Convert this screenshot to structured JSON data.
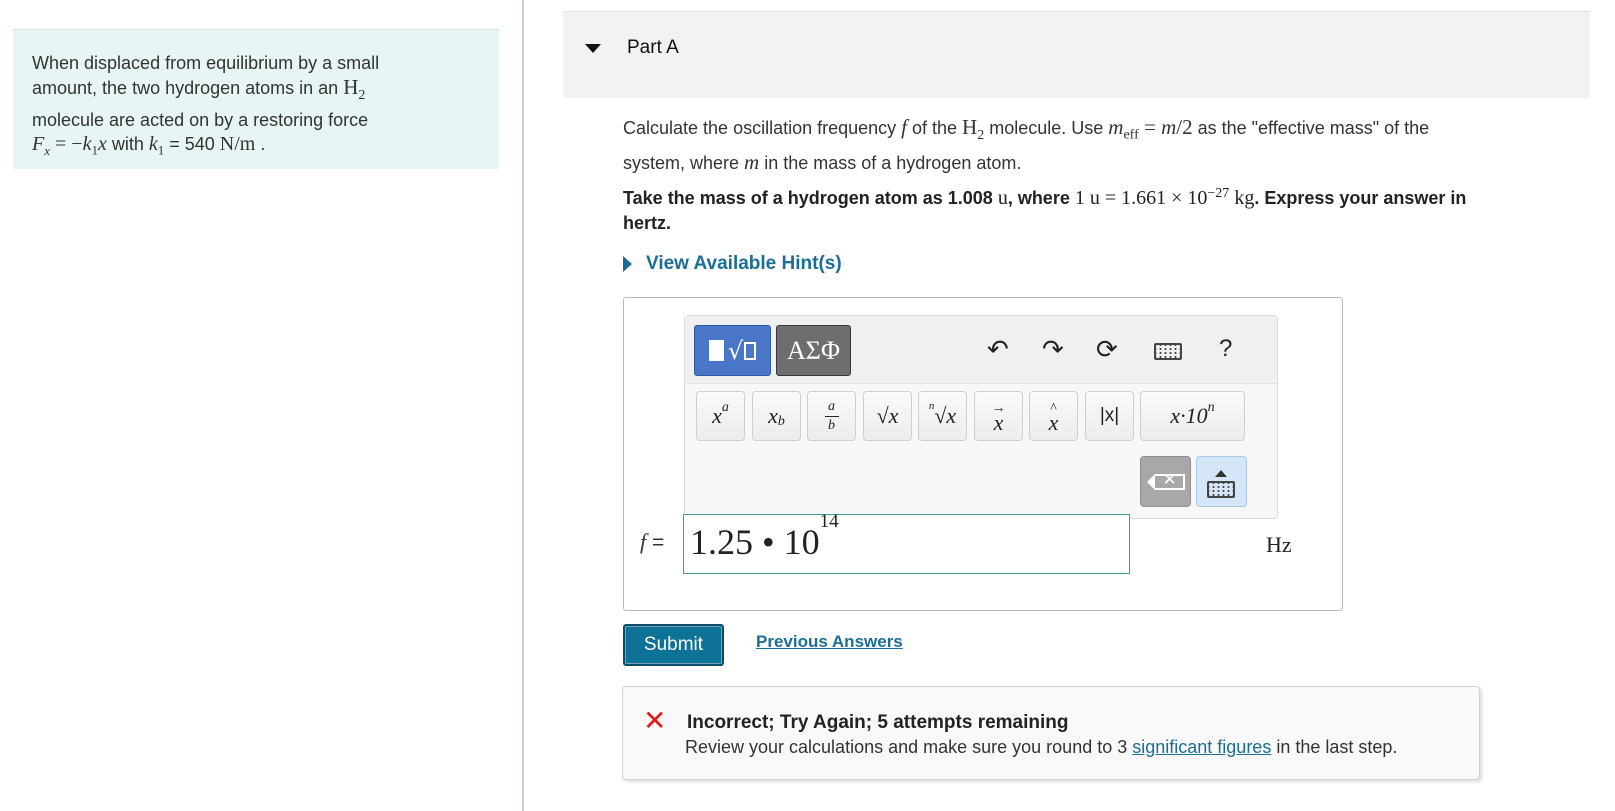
{
  "context": {
    "line1": "When displaced from equilibrium by a small",
    "line2_a": "amount, the two hydrogen atoms in an ",
    "line3": "molecule are acted on by a restoring force",
    "with_text": " with ",
    "k_value": " = 540 ",
    "units": "N/m",
    "period": " ."
  },
  "part": {
    "title": "Part A"
  },
  "question": {
    "p1": "Calculate the oscillation frequency ",
    "p2": " of the ",
    "p3": " molecule. Use ",
    "p4": " as the \"effective mass\" of the",
    "p5": "system, where ",
    "p6": " in the mass of a hydrogen atom."
  },
  "instruction": {
    "p1": "Take the mass of a hydrogen atom as 1.008 ",
    "u": "u",
    "p2": ", where ",
    "equation": "1 u = 1.661 × 10",
    "exponent": "−27",
    "kg": " kg",
    "p3": ". Express your answer in",
    "p4": "hertz."
  },
  "hints": {
    "label": "View Available Hint(s)"
  },
  "toolbar": {
    "greek_label": "ΑΣΦ",
    "help_label": "?",
    "keys": {
      "power": "x",
      "power_sup": "a",
      "subscript": "x",
      "subscript_sub": "b",
      "frac_num": "a",
      "frac_den": "b",
      "sqrt": "√x",
      "nroot_index": "n",
      "nroot": "√x",
      "vec": "x",
      "hat": "x",
      "abs": "|x|",
      "sci": "x·10",
      "sci_sup": "n"
    }
  },
  "answer": {
    "variable_label": "f =",
    "mantissa": "1.25 • 10",
    "exponent": "14",
    "unit": "Hz"
  },
  "actions": {
    "submit_label": "Submit",
    "previous_answers_label": "Previous Answers"
  },
  "feedback": {
    "title": "Incorrect; Try Again; 5 attempts remaining",
    "text_before": "Review your calculations and make sure you round to 3 ",
    "link": "significant figures",
    "text_after": " in the last step.",
    "status_color": "#e01b1b"
  },
  "colors": {
    "accent": "#1a6f94",
    "context_bg": "#e8f5f5",
    "submit_bg": "#0e7196"
  }
}
